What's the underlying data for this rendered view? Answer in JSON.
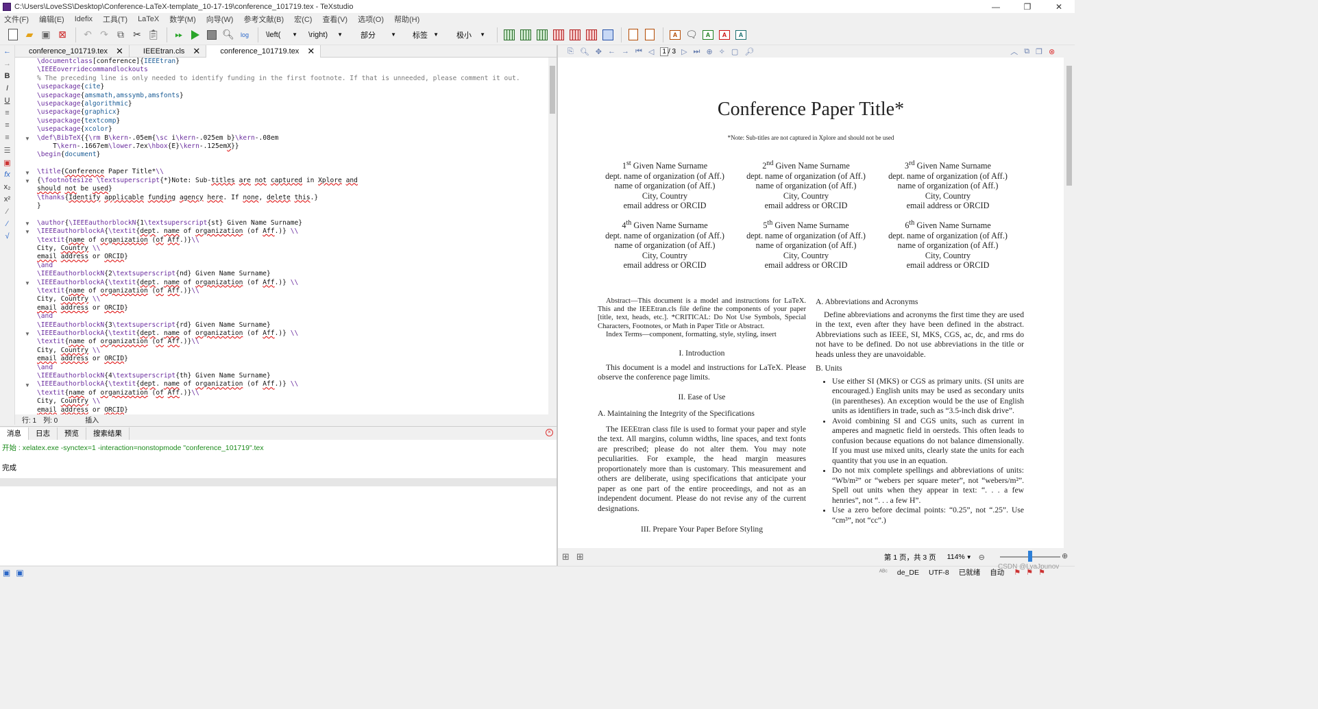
{
  "window": {
    "title": "C:\\Users\\LoveSS\\Desktop\\Conference-LaTeX-template_10-17-19\\conference_101719.tex - TeXstudio"
  },
  "menu": [
    "文件(F)",
    "编辑(E)",
    "Idefix",
    "工具(T)",
    "LaTeX",
    "数学(M)",
    "向导(W)",
    "参考文献(B)",
    "宏(C)",
    "查看(V)",
    "选项(O)",
    "帮助(H)"
  ],
  "toolbar": {
    "left_label": "\\left(",
    "right_label": "\\right)",
    "section_label": "部分",
    "label_label": "标签",
    "size_label": "极小"
  },
  "tabs": [
    {
      "label": "conference_101719.tex"
    },
    {
      "label": "IEEEtran.cls"
    },
    {
      "label": "conference_101719.tex"
    }
  ],
  "editor": {
    "status_row": "行: 1",
    "status_col": "列: 0",
    "status_mode": "插入"
  },
  "messages": {
    "tabs": [
      "消息",
      "日志",
      "预览",
      "搜索结果"
    ],
    "command": "开始 : xelatex.exe -synctex=1 -interaction=nonstopmode \"conference_101719\".tex",
    "done": "完成"
  },
  "pdf": {
    "page_current": "1",
    "page_total": "/ 3",
    "status_pages": "第 1 页，共 3 页",
    "zoom": "114%"
  },
  "paper": {
    "title": "Conference Paper Title*",
    "subtitle_note": "*Note: Sub-titles are not captured in Xplore and should not be used",
    "authors": [
      {
        "ord": "1",
        "sup": "st",
        "name": "Given Name Surname"
      },
      {
        "ord": "2",
        "sup": "nd",
        "name": "Given Name Surname"
      },
      {
        "ord": "3",
        "sup": "rd",
        "name": "Given Name Surname"
      },
      {
        "ord": "4",
        "sup": "th",
        "name": "Given Name Surname"
      },
      {
        "ord": "5",
        "sup": "th",
        "name": "Given Name Surname"
      },
      {
        "ord": "6",
        "sup": "th",
        "name": "Given Name Surname"
      }
    ],
    "aff_dept": "dept. name of organization (of Aff.)",
    "aff_org": "name of organization (of Aff.)",
    "aff_city": "City, Country",
    "aff_email": "email address or ORCID",
    "abstract": "Abstract—This document is a model and instructions for LaTeX. This and the IEEEtran.cls file define the components of your paper [title, text, heads, etc.]. *CRITICAL: Do Not Use Symbols, Special Characters, Footnotes, or Math in Paper Title or Abstract.",
    "index_terms": "Index Terms—component, formatting, style, styling, insert",
    "sec1": "I. Introduction",
    "intro": "This document is a model and instructions for LaTeX. Please observe the conference page limits.",
    "sec2": "II. Ease of Use",
    "sub2a": "A. Maintaining the Integrity of the Specifications",
    "integrity": "The IEEEtran class file is used to format your paper and style the text. All margins, column widths, line spaces, and text fonts are prescribed; please do not alter them. You may note peculiarities. For example, the head margin measures proportionately more than is customary. This measurement and others are deliberate, using specifications that anticipate your paper as one part of the entire proceedings, and not as an independent document. Please do not revise any of the current designations.",
    "sec3": "III. Prepare Your Paper Before Styling",
    "subA": "A. Abbreviations and Acronyms",
    "abbrev": "Define abbreviations and acronyms the first time they are used in the text, even after they have been defined in the abstract. Abbreviations such as IEEE, SI, MKS, CGS, ac, dc, and rms do not have to be defined. Do not use abbreviations in the title or heads unless they are unavoidable.",
    "subB": "B. Units",
    "units": [
      "Use either SI (MKS) or CGS as primary units. (SI units are encouraged.) English units may be used as secondary units (in parentheses). An exception would be the use of English units as identifiers in trade, such as “3.5-inch disk drive”.",
      "Avoid combining SI and CGS units, such as current in amperes and magnetic field in oersteds. This often leads to confusion because equations do not balance dimensionally. If you must use mixed units, clearly state the units for each quantity that you use in an equation.",
      "Do not mix complete spellings and abbreviations of units: “Wb/m²” or “webers per square meter”, not “webers/m²”. Spell out units when they appear in text: “. . . a few henries”, not “. . . a few H”.",
      "Use a zero before decimal points: “0.25”, not “.25”. Use “cm³”, not “cc”.)"
    ]
  },
  "statusbar": {
    "lang": "de_DE",
    "enc": "UTF-8",
    "ready": "已就绪",
    "auto": "自动"
  },
  "watermark": "CSDN @LyaJpunov"
}
